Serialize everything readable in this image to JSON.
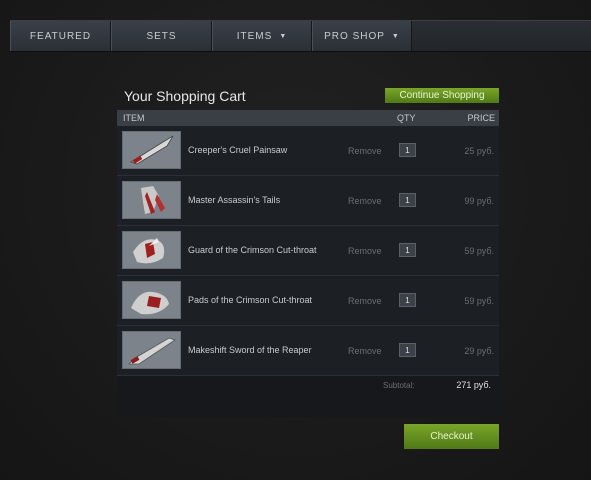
{
  "nav": {
    "tabs": [
      {
        "label": "FEATURED"
      },
      {
        "label": "SETS"
      },
      {
        "label": "ITEMS"
      },
      {
        "label": "PRO SHOP"
      }
    ]
  },
  "cart": {
    "title": "Your Shopping Cart",
    "continue_label": "Continue Shopping",
    "headers": {
      "item": "ITEM",
      "qty": "QTY",
      "price": "PRICE"
    },
    "items": [
      {
        "name": "Creeper's Cruel Painsaw",
        "remove": "Remove",
        "qty": "1",
        "price": "25 руб.",
        "icon": "painsaw-icon"
      },
      {
        "name": "Master Assassin's Tails",
        "remove": "Remove",
        "qty": "1",
        "price": "99 руб.",
        "icon": "tails-icon"
      },
      {
        "name": "Guard of the Crimson Cut-throat",
        "remove": "Remove",
        "qty": "1",
        "price": "59 руб.",
        "icon": "guard-icon"
      },
      {
        "name": "Pads of the Crimson Cut-throat",
        "remove": "Remove",
        "qty": "1",
        "price": "59 руб.",
        "icon": "pads-icon"
      },
      {
        "name": "Makeshift Sword of the Reaper",
        "remove": "Remove",
        "qty": "1",
        "price": "29 руб.",
        "icon": "sword-icon"
      }
    ],
    "subtotal_label": "Subtotal:",
    "subtotal_value": "271 руб.",
    "checkout_label": "Checkout"
  },
  "colors": {
    "accent_green": "#6a9a22",
    "header_bg": "#3a3f46"
  }
}
